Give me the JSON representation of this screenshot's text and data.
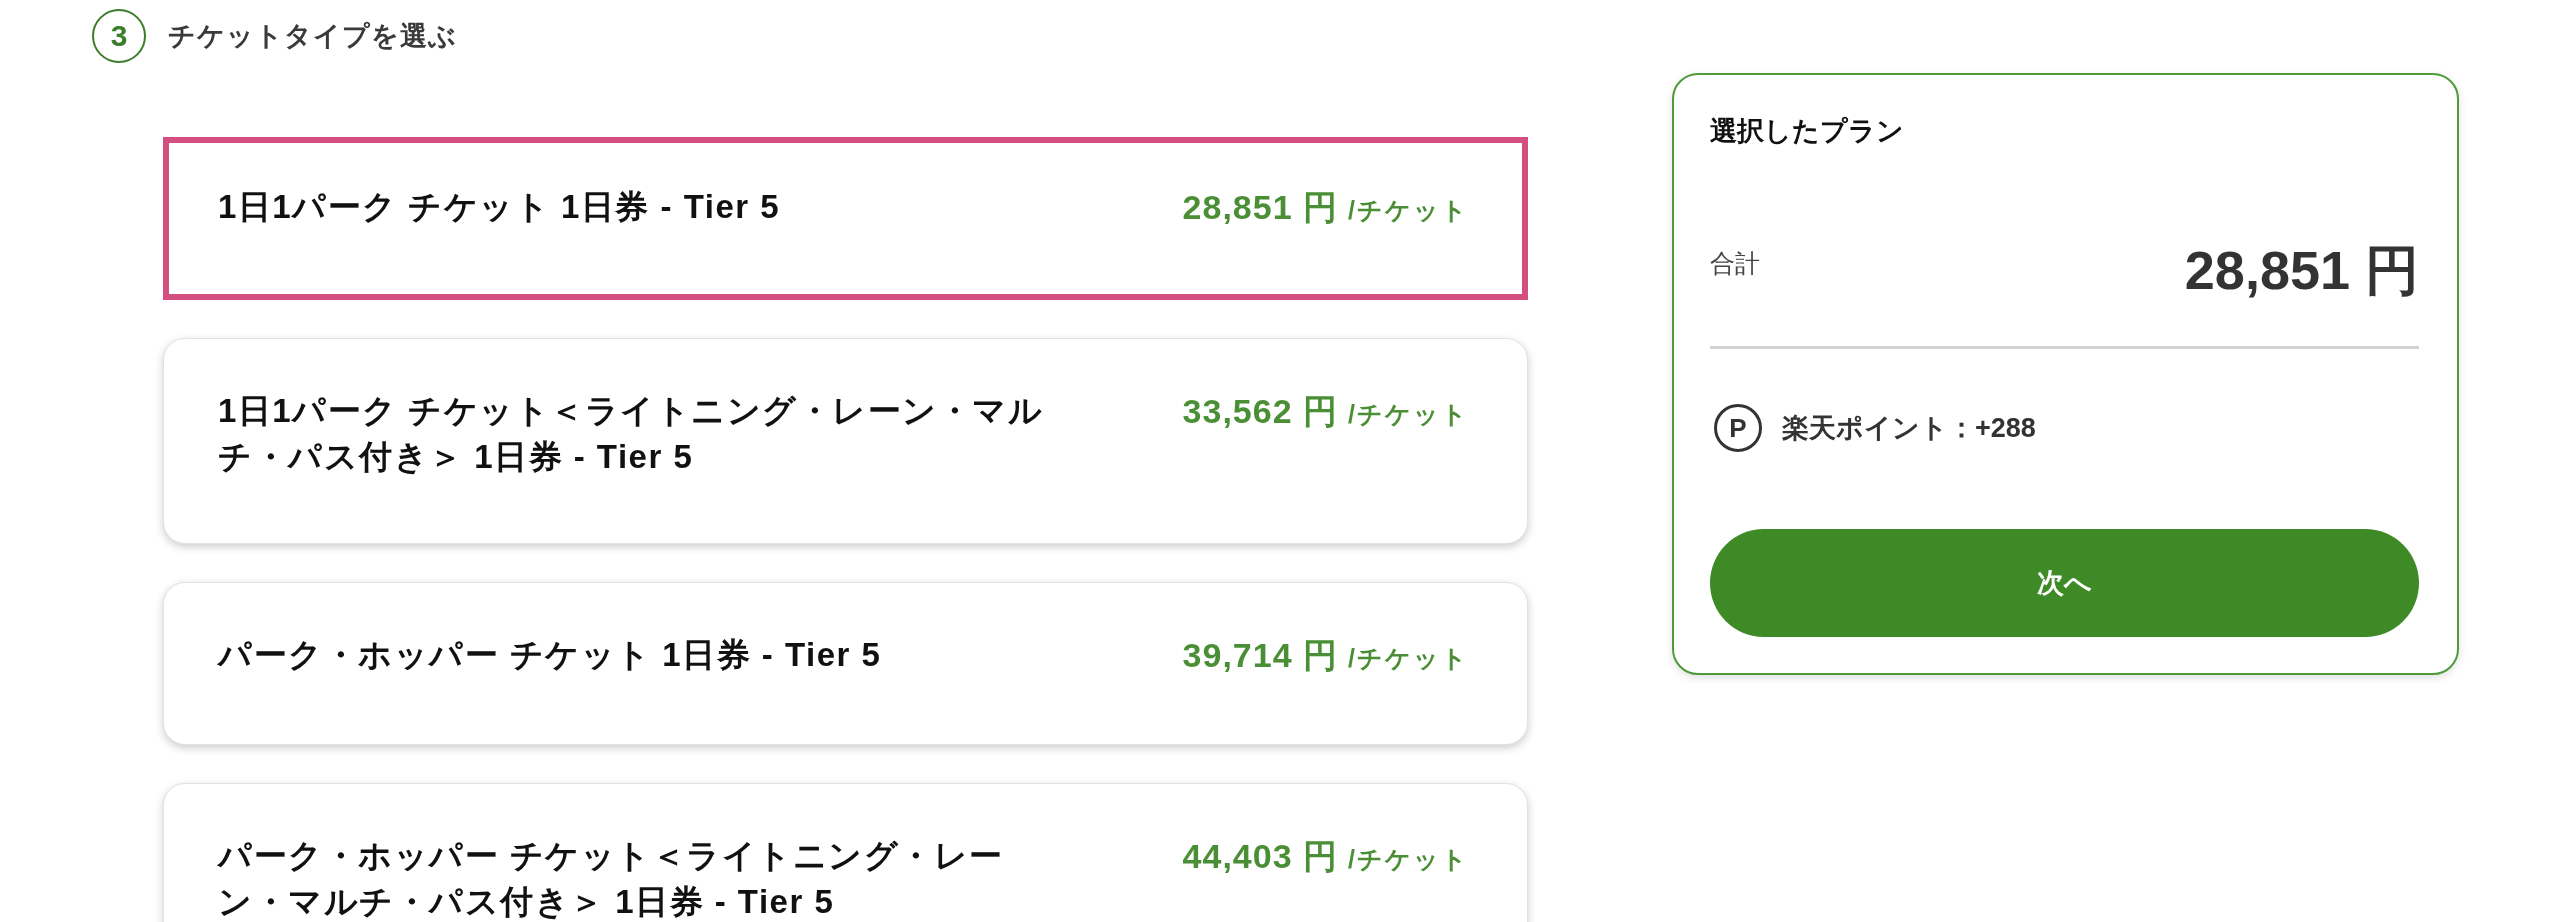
{
  "step": {
    "number": "3",
    "title": "チケットタイプを選ぶ"
  },
  "tickets": [
    {
      "name": "1日1パーク チケット 1日券 - Tier 5",
      "price": "28,851 円",
      "unit": "/チケット",
      "selected": true
    },
    {
      "name": "1日1パーク チケット＜ライトニング・レーン・マルチ・パス付き＞ 1日券 - Tier 5",
      "price": "33,562 円",
      "unit": "/チケット",
      "selected": false
    },
    {
      "name": "パーク・ホッパー チケット 1日券 - Tier 5",
      "price": "39,714 円",
      "unit": "/チケット",
      "selected": false
    },
    {
      "name": "パーク・ホッパー チケット＜ライトニング・レーン・マルチ・パス付き＞ 1日券 - Tier 5",
      "price": "44,403 円",
      "unit": "/チケット",
      "selected": false
    }
  ],
  "summary": {
    "title": "選択したプラン",
    "total_label": "合計",
    "total": "28,851 円",
    "points_icon": "P",
    "points": "楽天ポイント：+288",
    "next_button": "次へ"
  }
}
